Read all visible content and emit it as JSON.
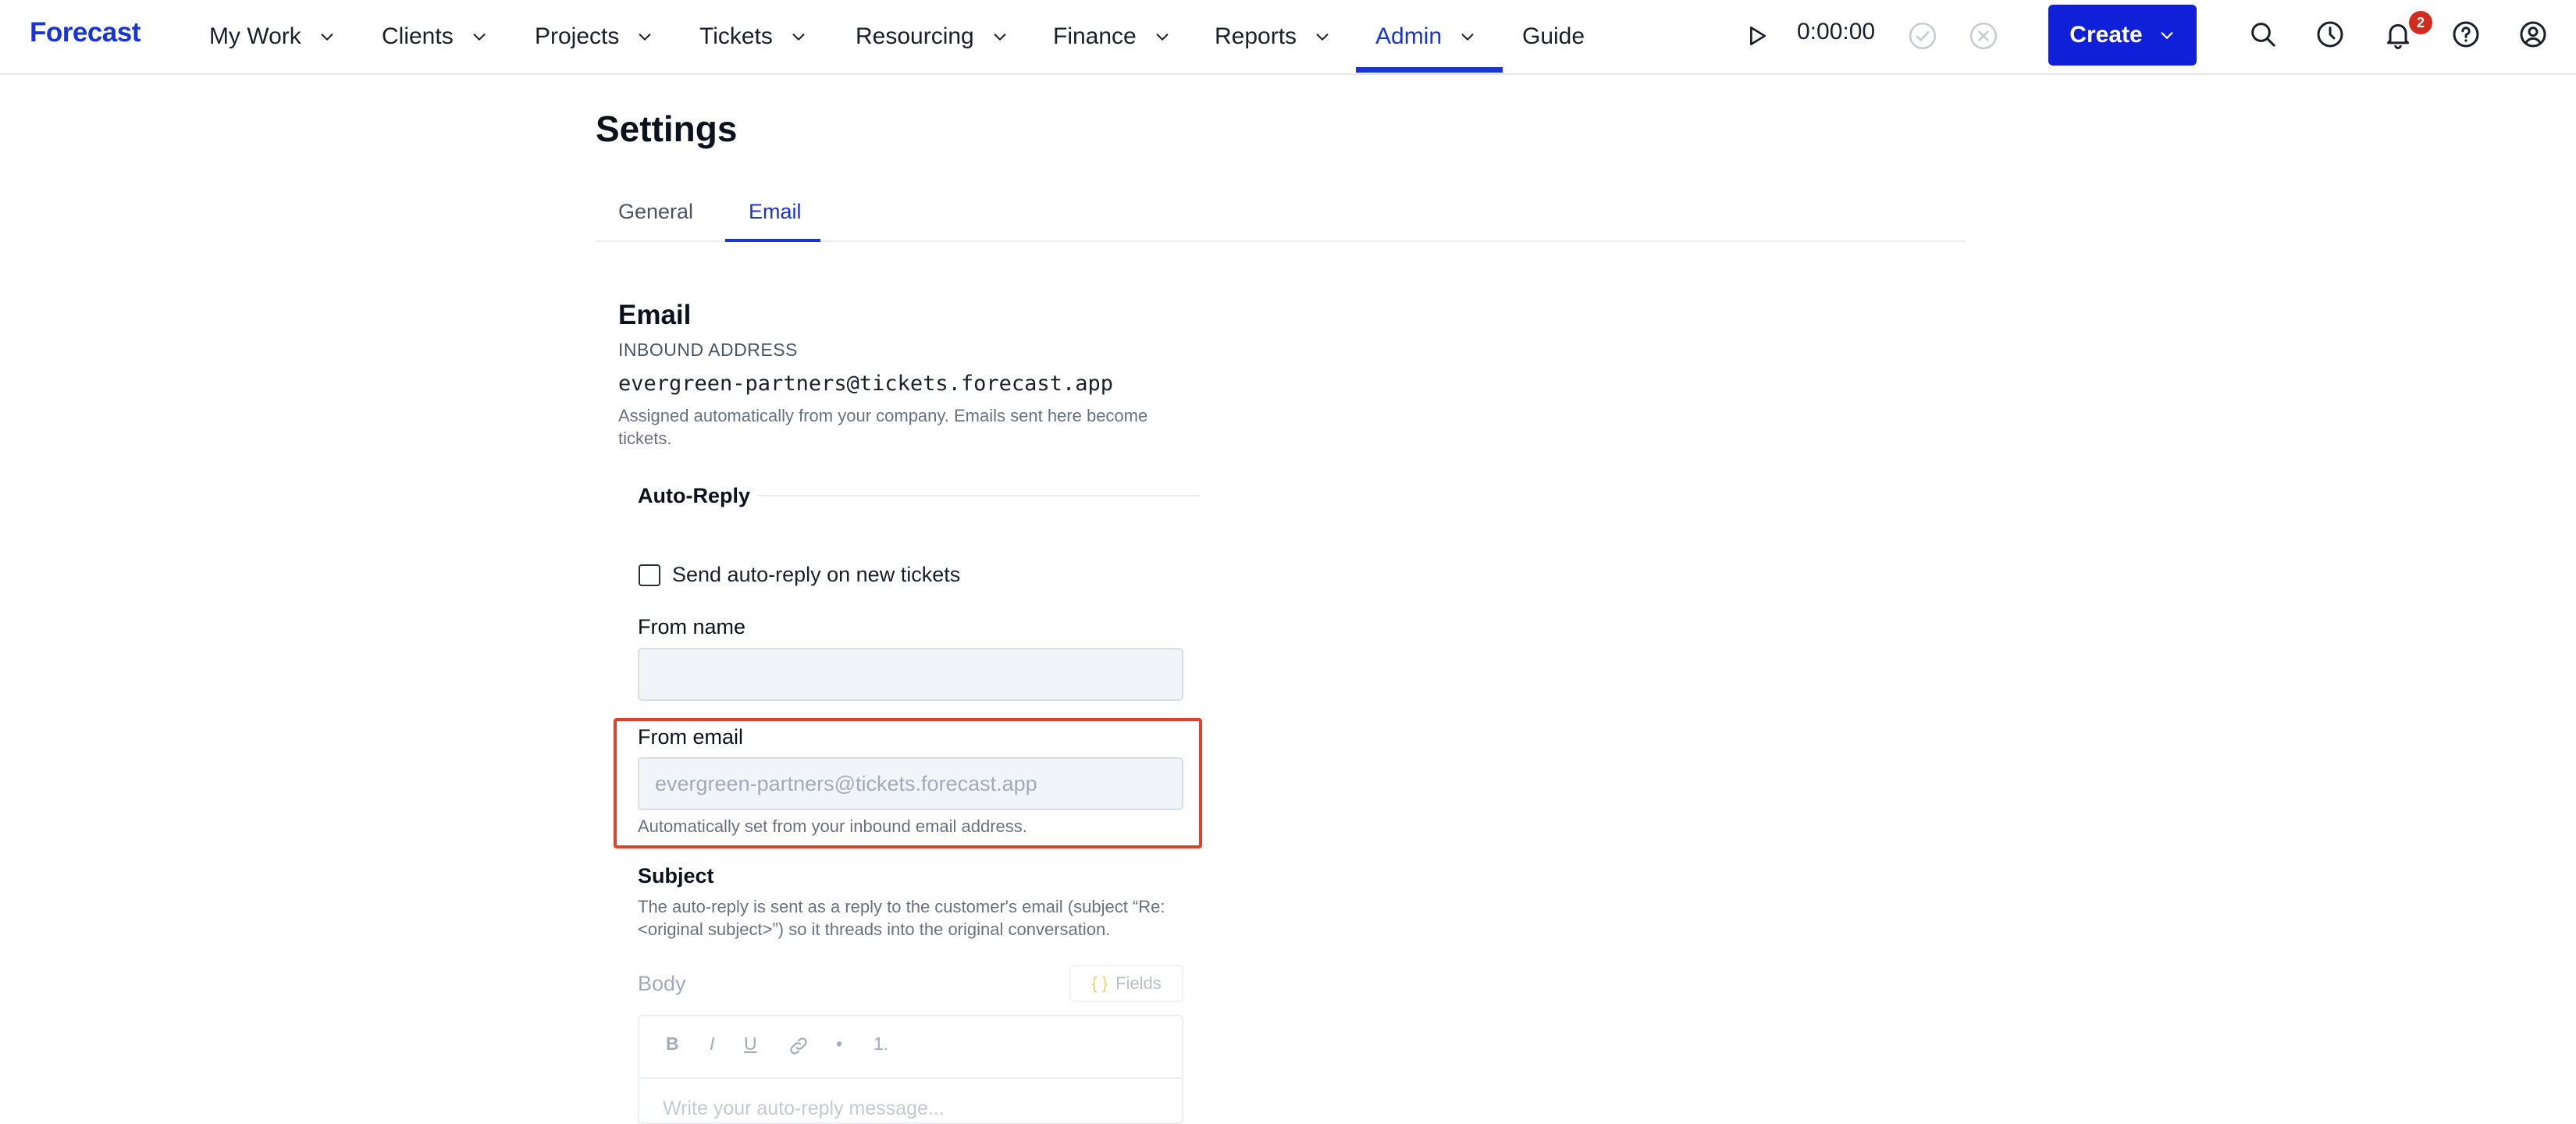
{
  "app": {
    "logo": "Forecast"
  },
  "nav": {
    "items": [
      {
        "label": "My Work"
      },
      {
        "label": "Clients"
      },
      {
        "label": "Projects"
      },
      {
        "label": "Tickets"
      },
      {
        "label": "Resourcing"
      },
      {
        "label": "Finance"
      },
      {
        "label": "Reports"
      },
      {
        "label": "Admin",
        "active": true
      },
      {
        "label": "Guide"
      }
    ],
    "timer": "0:00:00",
    "create_label": "Create",
    "notifications_count": "2",
    "accent_color": "#1834d6"
  },
  "page": {
    "title": "Settings",
    "tabs": [
      {
        "label": "General"
      },
      {
        "label": "Email",
        "active": true
      }
    ]
  },
  "email": {
    "section_title": "Email",
    "inbound_label": "INBOUND ADDRESS",
    "inbound_address": "evergreen-partners@tickets.forecast.app",
    "inbound_help": "Assigned automatically from your company. Emails sent here become tickets."
  },
  "autoreply": {
    "title": "Auto-Reply",
    "checkbox_label": "Send auto-reply on new tickets",
    "checkbox_checked": false,
    "from_name_label": "From name",
    "from_name_value": "",
    "from_email_label": "From email",
    "from_email_placeholder": "evergreen-partners@tickets.forecast.app",
    "from_email_help": "Automatically set from your inbound email address.",
    "subject_label": "Subject",
    "subject_help": "The auto-reply is sent as a reply to the customer's email (subject “Re: <original subject>”) so it threads into the original conversation.",
    "body_label": "Body",
    "fields_label": "Fields",
    "toolbar": {
      "bold": "B",
      "italic": "I",
      "underline": "U",
      "bullet": "•",
      "numbered": "1."
    },
    "body_placeholder": "Write your auto-reply message..."
  }
}
